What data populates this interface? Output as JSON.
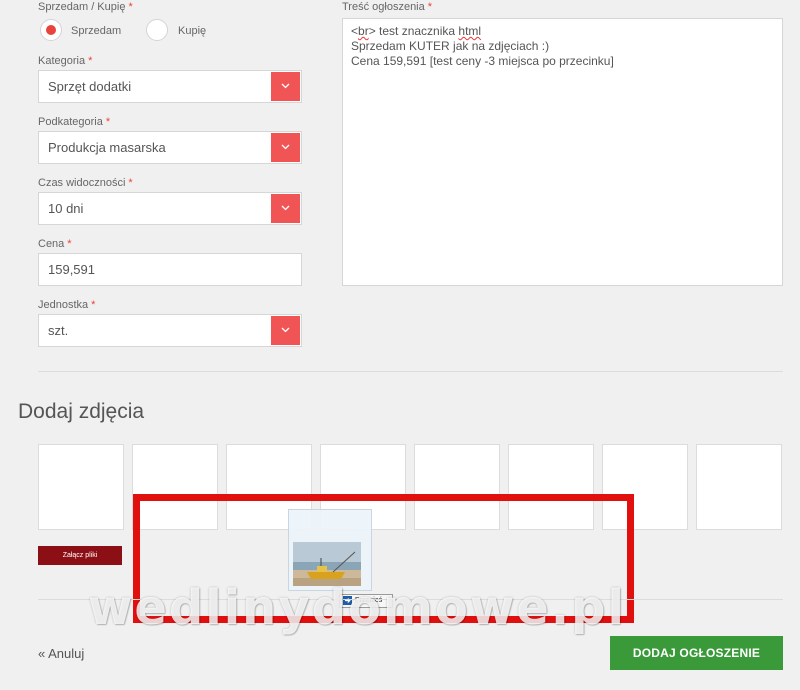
{
  "form": {
    "sell_buy": {
      "label": "Sprzedam / Kupię",
      "required_mark": "*",
      "options": [
        {
          "label": "Sprzedam",
          "checked": true
        },
        {
          "label": "Kupię",
          "checked": false
        }
      ]
    },
    "category": {
      "label": "Kategoria",
      "required_mark": "*",
      "value": "Sprzęt dodatki"
    },
    "subcategory": {
      "label": "Podkategoria",
      "required_mark": "*",
      "value": "Produkcja masarska"
    },
    "visibility": {
      "label": "Czas widoczności",
      "required_mark": "*",
      "value": "10 dni"
    },
    "price": {
      "label": "Cena",
      "required_mark": "*",
      "value": "159,591"
    },
    "unit": {
      "label": "Jednostka",
      "required_mark": "*",
      "value": "szt."
    },
    "content": {
      "label": "Treść ogłoszenia",
      "required_mark": "*",
      "line1_prefix": "<",
      "line1_br": "br",
      "line1_mid": "> test znacznika ",
      "line1_html": "html",
      "line2": "Sprzedam KUTER jak na zdjęciach :)",
      "line3": "Cena 159,591 [test ceny -3 miejsca po przecinku]"
    }
  },
  "photos": {
    "title": "Dodaj zdjęcia",
    "slot_count": 8,
    "attach_button": "Załącz pliki",
    "drag_tooltip": "Przenieś"
  },
  "footer": {
    "cancel": "« Anuluj",
    "submit": "DODAJ OGŁOSZENIE"
  },
  "watermark": "wedlinydomowe.pl",
  "colors": {
    "accent_red": "#f05454",
    "radio_dot": "#e8443a",
    "attach_button": "#8c0f16",
    "submit_button": "#3a9a3a",
    "highlight": "#e20f0f"
  }
}
